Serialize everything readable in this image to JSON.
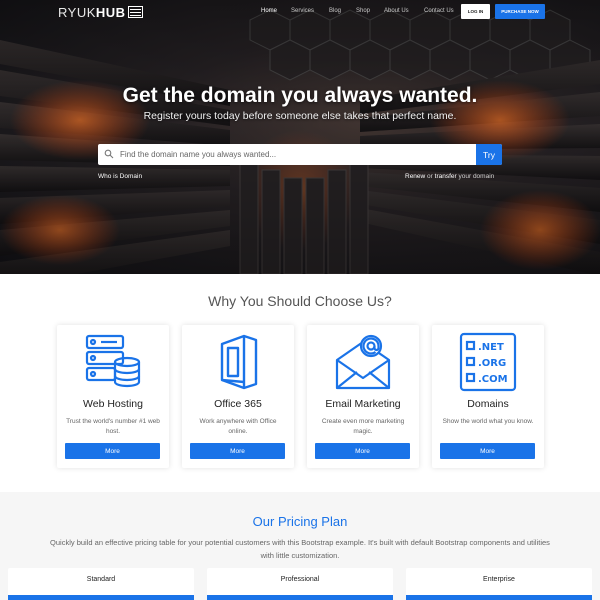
{
  "header": {
    "logo_text_light": "RYUK",
    "logo_text_bold": "HUB",
    "nav": [
      "Home",
      "Services",
      "Blog",
      "Shop",
      "About Us",
      "Contact Us"
    ],
    "login_label": "LOG IN",
    "purchase_label": "PURCHASE NOW"
  },
  "hero": {
    "title": "Get the domain you always wanted.",
    "subtitle": "Register yours today before someone else takes that perfect name.",
    "search_placeholder": "Find the domain name you always wanted...",
    "search_button": "Try",
    "who_is": "Who is Domain",
    "renew_a": "Renew",
    "renew_or": " or ",
    "renew_b": "transfer",
    "renew_tail": " your domain"
  },
  "why": {
    "title": "Why You Should Choose Us?",
    "cards": [
      {
        "icon": "server-database-icon",
        "title": "Web Hosting",
        "desc": "Trust the world's number #1 web host.",
        "button": "More"
      },
      {
        "icon": "office-365-icon",
        "title": "Office 365",
        "desc": "Work anywhere with Office online.",
        "button": "More"
      },
      {
        "icon": "email-envelope-icon",
        "title": "Email Marketing",
        "desc": "Create even more marketing magic.",
        "button": "More"
      },
      {
        "icon": "domains-list-icon",
        "title": "Domains",
        "desc": "Show the world what you know.",
        "button": "More"
      }
    ],
    "domain_tlds": [
      ".NET",
      ".ORG",
      ".COM"
    ]
  },
  "pricing": {
    "title": "Our Pricing Plan",
    "desc": "Quickly build an effective pricing table for your potential customers with this Bootstrap example. It's built with default Bootstrap components and utilities with little customization.",
    "plans": [
      "Standard",
      "Professional",
      "Enterprise"
    ]
  },
  "colors": {
    "accent": "#1a73e8"
  }
}
